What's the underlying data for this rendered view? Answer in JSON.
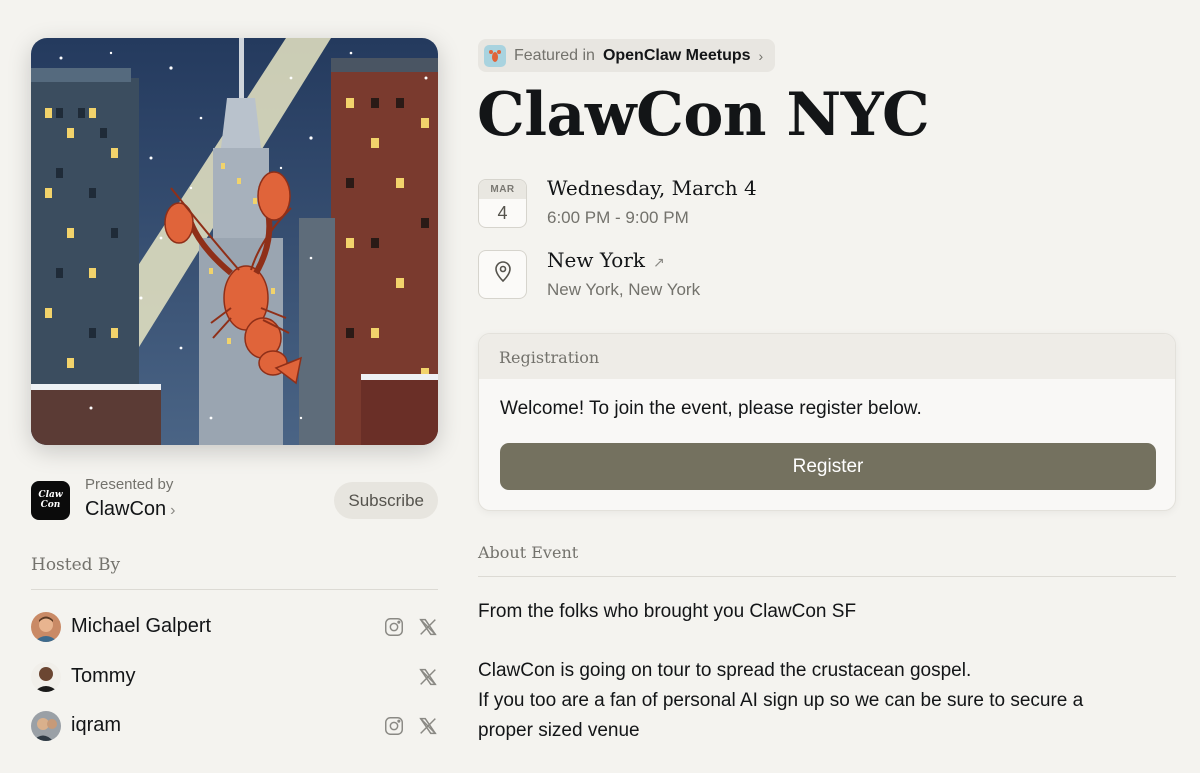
{
  "cover": {
    "image": "lobster-empire-state-snow-illustration",
    "alt": "ClawCon NYC cover art"
  },
  "presenter": {
    "logo_text_1": "Claw",
    "logo_text_2": "Con",
    "presented_by_label": "Presented by",
    "name": "ClawCon",
    "subscribe_label": "Subscribe"
  },
  "hosted": {
    "title": "Hosted By",
    "hosts": [
      {
        "name": "Michael Galpert",
        "socials": [
          "instagram-icon",
          "x-icon"
        ]
      },
      {
        "name": "Tommy",
        "socials": [
          "x-icon"
        ]
      },
      {
        "name": "iqram",
        "socials": [
          "instagram-icon",
          "x-icon"
        ]
      }
    ]
  },
  "featured": {
    "prefix": "Featured in",
    "calendar": "OpenClaw Meetups",
    "icon": "lobster-icon"
  },
  "event": {
    "title": "ClawCon NYC",
    "date": {
      "month": "MAR",
      "day": "4",
      "full": "Wednesday, March 4",
      "time": "6:00 PM - 9:00 PM"
    },
    "location": {
      "name": "New York",
      "detail": "New York, New York",
      "icon": "map-pin-icon"
    }
  },
  "registration": {
    "header": "Registration",
    "message": "Welcome! To join the event, please register below.",
    "button_label": "Register"
  },
  "about": {
    "title": "About Event",
    "paragraphs": [
      "From the folks who brought you ClawCon SF",
      "ClawCon is going on tour to spread the crustacean gospel.",
      "If you too are a fan of personal AI sign up so we can be sure to secure a",
      "proper sized venue"
    ]
  },
  "colors": {
    "background": "#f4f3ef",
    "register_button": "#74715f",
    "text_primary": "#131517",
    "text_secondary": "#73726c"
  }
}
